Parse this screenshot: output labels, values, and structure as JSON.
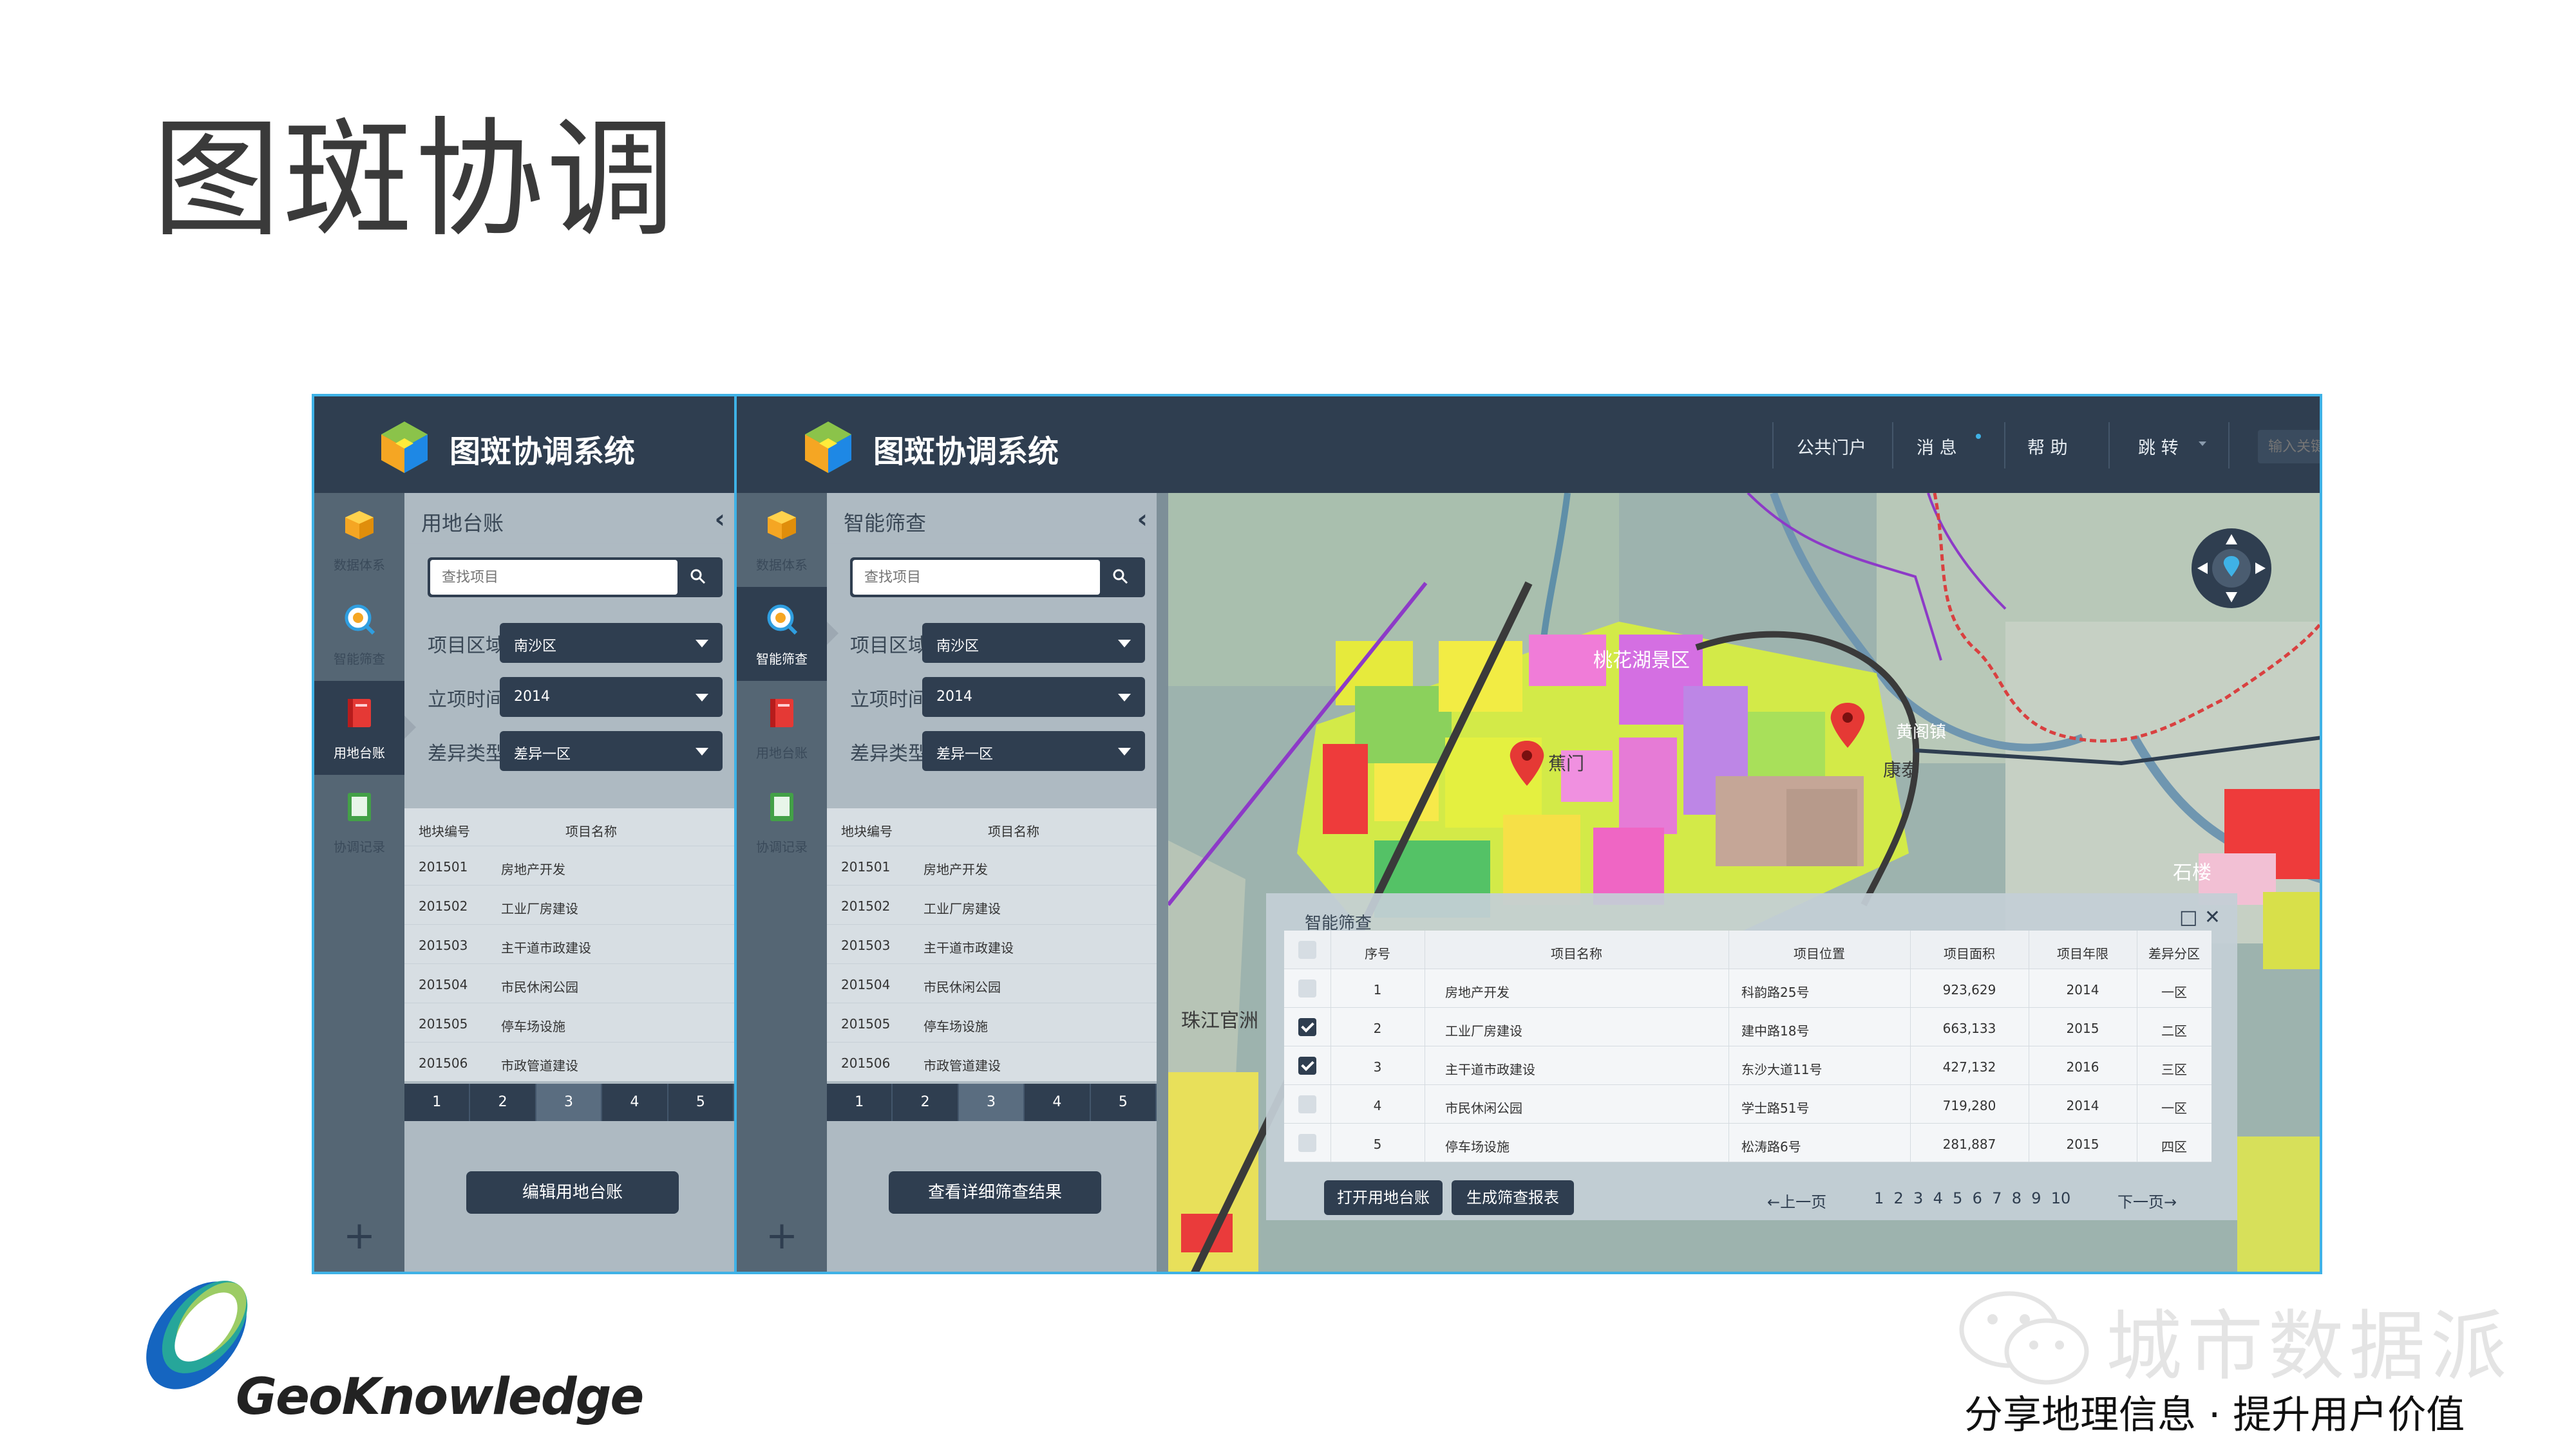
{
  "slide": {
    "title": "图斑协调",
    "brand_name": "GeoKnowledge",
    "watermark": "城市数据派",
    "slogan": "分享地理信息 · 提升用户价值"
  },
  "app": {
    "title": "图斑协调系统",
    "nav": [
      "公共门户",
      "消 息",
      "帮 助",
      "跳 转"
    ],
    "search_placeholder": "输入关键词搜索"
  },
  "rail": {
    "items": [
      "数据体系",
      "智能筛查",
      "用地台账",
      "协调记录"
    ],
    "add_label": "+"
  },
  "panels": [
    {
      "title": "用地台账",
      "search_placeholder": "查找项目",
      "fields": [
        {
          "label": "项目区域",
          "value": "南沙区"
        },
        {
          "label": "立项时间",
          "value": "2014"
        },
        {
          "label": "差异类型",
          "value": "差异一区"
        }
      ],
      "table_headers": [
        "地块编号",
        "项目名称"
      ],
      "rows": [
        [
          "201501",
          "房地产开发"
        ],
        [
          "201502",
          "工业厂房建设"
        ],
        [
          "201503",
          "主干道市政建设"
        ],
        [
          "201504",
          "市民休闲公园"
        ],
        [
          "201505",
          "停车场设施"
        ],
        [
          "201506",
          "市政管道建设"
        ]
      ],
      "pages": [
        "1",
        "2",
        "3",
        "4",
        "5"
      ],
      "current_page": "3",
      "button": "编辑用地台账"
    },
    {
      "title": "智能筛查",
      "search_placeholder": "查找项目",
      "fields": [
        {
          "label": "项目区域",
          "value": "南沙区"
        },
        {
          "label": "立项时间",
          "value": "2014"
        },
        {
          "label": "差异类型",
          "value": "差异一区"
        }
      ],
      "table_headers": [
        "地块编号",
        "项目名称"
      ],
      "rows": [
        [
          "201501",
          "房地产开发"
        ],
        [
          "201502",
          "工业厂房建设"
        ],
        [
          "201503",
          "主干道市政建设"
        ],
        [
          "201504",
          "市民休闲公园"
        ],
        [
          "201505",
          "停车场设施"
        ],
        [
          "201506",
          "市政管道建设"
        ]
      ],
      "pages": [
        "1",
        "2",
        "3",
        "4",
        "5"
      ],
      "current_page": "3",
      "button": "查看详细筛查结果"
    }
  ],
  "map": {
    "labels": [
      "桃花湖景区",
      "蕉门",
      "康泰",
      "黄阁镇",
      "珠江官洲",
      "石楼"
    ]
  },
  "dialog": {
    "title": "智能筛查",
    "headers": [
      "序号",
      "项目名称",
      "项目位置",
      "项目面积",
      "项目年限",
      "差异分区"
    ],
    "rows": [
      {
        "checked": false,
        "cells": [
          "1",
          "房地产开发",
          "科韵路25号",
          "923,629",
          "2014",
          "一区"
        ]
      },
      {
        "checked": true,
        "cells": [
          "2",
          "工业厂房建设",
          "建中路18号",
          "663,133",
          "2015",
          "二区"
        ]
      },
      {
        "checked": true,
        "cells": [
          "3",
          "主干道市政建设",
          "东沙大道11号",
          "427,132",
          "2016",
          "三区"
        ]
      },
      {
        "checked": false,
        "cells": [
          "4",
          "市民休闲公园",
          "学士路51号",
          "719,280",
          "2014",
          "一区"
        ]
      },
      {
        "checked": false,
        "cells": [
          "5",
          "停车场设施",
          "松涛路6号",
          "281,887",
          "2015",
          "四区"
        ]
      }
    ],
    "buttons": [
      "打开用地台账",
      "生成筛查报表"
    ],
    "prev": "←上一页",
    "pages": "1  2  3  4  5  6  7  8  9  10",
    "next": "下一页→"
  }
}
